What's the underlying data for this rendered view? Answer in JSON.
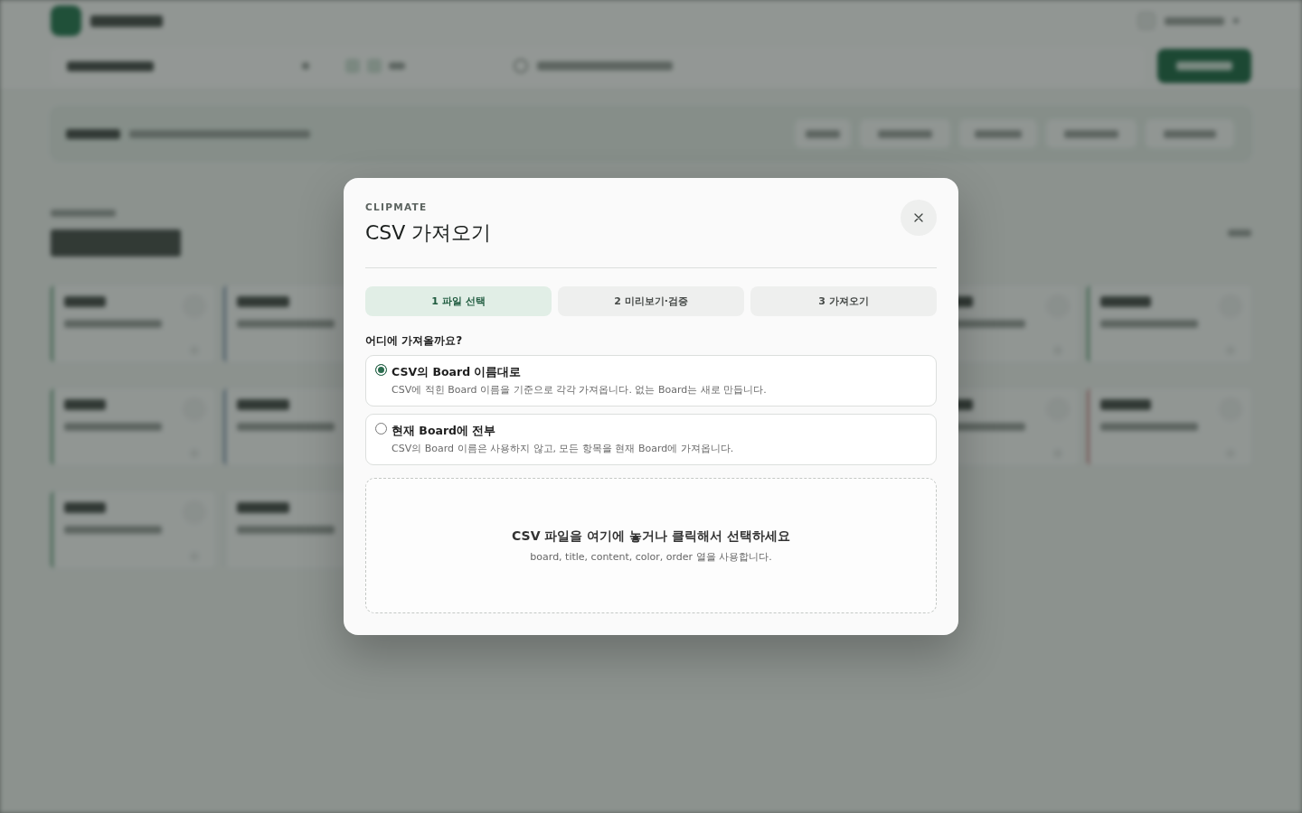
{
  "dialog": {
    "eyebrow": "CLIPMATE",
    "title": "CSV 가져오기"
  },
  "steps": [
    {
      "label": "1 파일 선택",
      "selected": true
    },
    {
      "label": "2 미리보기·검증",
      "selected": false
    },
    {
      "label": "3 가져오기",
      "selected": false
    }
  ],
  "question": "어디에 가져올까요?",
  "options": [
    {
      "title": "CSV의 Board 이름대로",
      "description": "CSV에 적힌 Board 이름을 기준으로 각각 가져옵니다. 없는 Board는 새로 만듭니다.",
      "selected": true
    },
    {
      "title": "현재 Board에 전부",
      "description": "CSV의 Board 이름은 사용하지 않고, 모든 항목을 현재 Board에 가져옵니다.",
      "selected": false
    }
  ],
  "dropzone": {
    "title": "CSV 파일을 여기에 놓거나 클릭해서 선택하세요",
    "hint": "board, title, content, color, order 열을 사용합니다."
  }
}
